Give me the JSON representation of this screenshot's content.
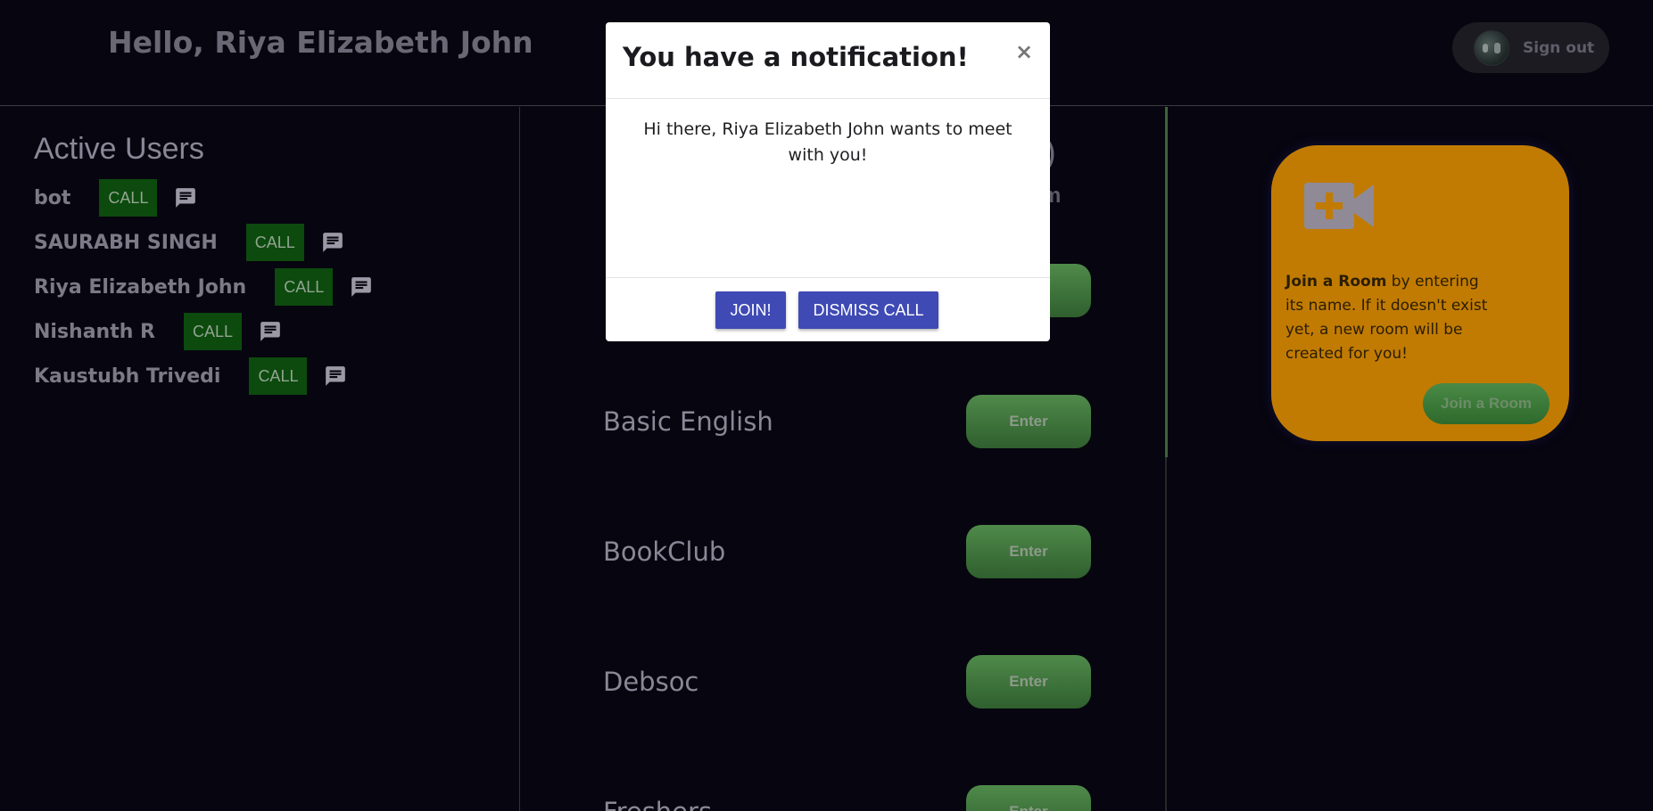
{
  "header": {
    "greeting": "Hello, Riya Elizabeth John",
    "signout_label": "Sign out"
  },
  "active_users": {
    "title": "Active Users",
    "call_label": "CALL",
    "users": [
      {
        "name": "bot"
      },
      {
        "name": "SAURABH SINGH"
      },
      {
        "name": "Riya Elizabeth John"
      },
      {
        "name": "Nishanth R"
      },
      {
        "name": "Kaustubh Trivedi"
      }
    ]
  },
  "rooms": {
    "heading_fragment": "d)",
    "subheading_fragment": "m",
    "enter_label": "Enter",
    "list": [
      {
        "name": "Basic English"
      },
      {
        "name": "BookClub"
      },
      {
        "name": "Debsoc"
      },
      {
        "name": "Freshers"
      }
    ]
  },
  "join_card": {
    "strong_text": "Join a Room",
    "text": " by entering its name. If it doesn't exist yet, a new room will be created for you!",
    "button_label": "Join a Room"
  },
  "modal": {
    "title": "You have a notification!",
    "close_symbol": "×",
    "body": "Hi there, Riya Elizabeth John wants to meet with you!",
    "join_label": "JOIN!",
    "dismiss_label": "DISMISS CALL"
  }
}
